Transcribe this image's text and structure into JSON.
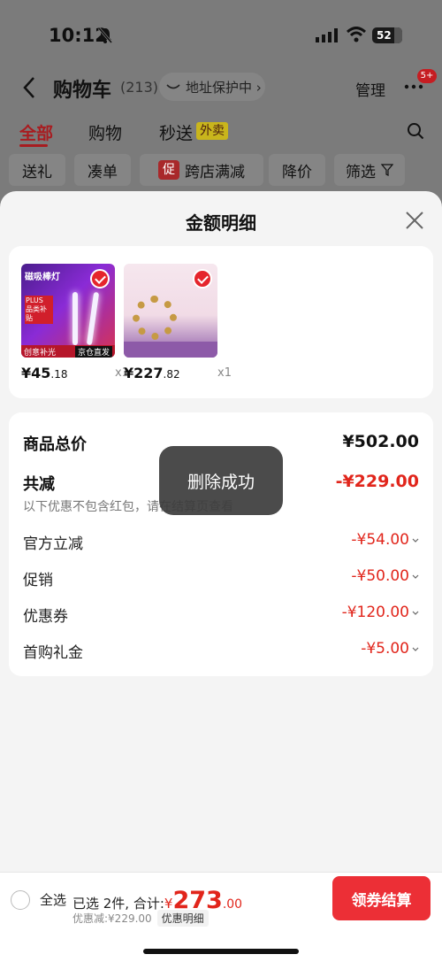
{
  "status": {
    "time": "10:12",
    "battery": "52"
  },
  "nav": {
    "title": "购物车",
    "count": "(213)",
    "address_protect": "地址保护中 ›",
    "manage": "管理",
    "more_badge": "5+"
  },
  "tabs": {
    "all": "全部",
    "shop": "购物",
    "express": "秒送",
    "express_tag": "外卖"
  },
  "chips": {
    "gift": "送礼",
    "bundle": "凑单",
    "cross_tag": "促",
    "cross_store": "跨店满减",
    "price_drop": "降价",
    "filter": "筛选"
  },
  "sheet": {
    "title": "金额明细",
    "products": [
      {
        "price_int": "¥45",
        "price_dec": ".18",
        "qty": "x1",
        "img_title": "磁吸棒灯",
        "img_promo": "PLUS 品类补贴",
        "img_strip_left": "创意补光",
        "img_strip_right": "京仓直发"
      },
      {
        "price_int": "¥227",
        "price_dec": ".82",
        "qty": "x1"
      }
    ],
    "detail": {
      "total_label": "商品总价",
      "total_value": "¥502.00",
      "reduce_label": "共减",
      "reduce_value": "-¥229.00",
      "note": "以下优惠不包含红包，请在结算页查看",
      "items": [
        {
          "label": "官方立减",
          "value": "-¥54.00"
        },
        {
          "label": "促销",
          "value": "-¥50.00"
        },
        {
          "label": "优惠券",
          "value": "-¥120.00"
        },
        {
          "label": "首购礼金",
          "value": "-¥5.00"
        }
      ]
    },
    "toast": "删除成功"
  },
  "bottom": {
    "select_all": "全选",
    "selected_text": "已选 2件, 合计:",
    "yen": "¥",
    "amount_int": "273",
    "amount_dec": ".00",
    "discount": "优惠减:¥229.00",
    "detail_tag": "优惠明细",
    "checkout": "领券结算"
  },
  "colors": {
    "accent": "#e1251b",
    "checkout": "#ec2f36",
    "scrim": "#7b7b7b"
  }
}
